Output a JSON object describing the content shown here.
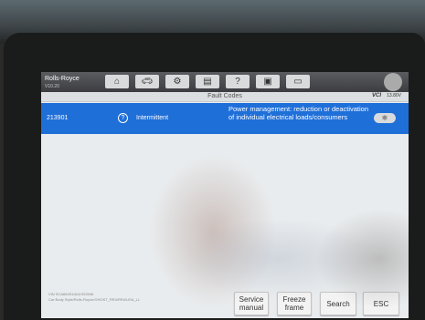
{
  "device": {
    "vehicle_make": "Rolls-Royce",
    "vehicle_model": "V10.20",
    "toolbar": {
      "home_icon": "home-icon",
      "car_icon": "car-icon",
      "settings_icon": "gear-icon",
      "print_icon": "printer-icon",
      "help_icon": "help-icon",
      "save_icon": "save-icon",
      "chat_icon": "chat-icon"
    },
    "page_title": "Fault Codes",
    "vci_label": "VCI",
    "voltage_label": "13.80V"
  },
  "faults": [
    {
      "code": "213901",
      "status": "Intermittent",
      "description": "Power management: reduction or deactivation of individual electrical loads/consumers"
    }
  ],
  "footer": {
    "vin_line1": "VIN SCA664S44UUX53046",
    "vin_line2": "Car Body Style/Rolls-Royce/GHOST_RR4/RR4/USA_LL",
    "buttons": {
      "service_manual": "Service manual",
      "freeze_frame": "Freeze frame",
      "search": "Search",
      "esc": "ESC"
    }
  },
  "colors": {
    "highlight": "#1f6fd9",
    "topbar": "#4a4c50",
    "screen_bg": "#e9ecee"
  }
}
